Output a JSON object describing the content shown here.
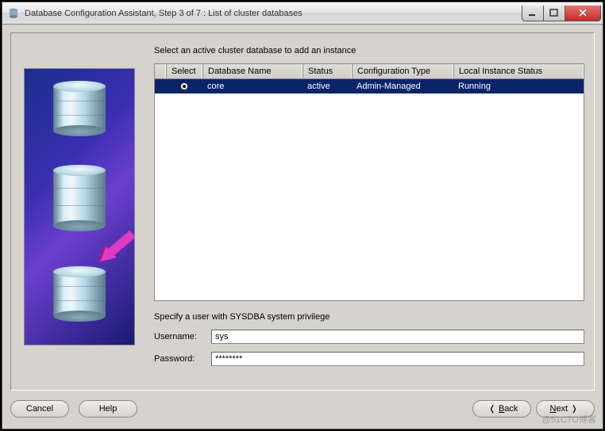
{
  "window": {
    "title": "Database Configuration Assistant, Step 3 of 7 : List of cluster databases"
  },
  "instruction": "Select an active cluster database to add an instance",
  "table": {
    "headers": {
      "select": "Select",
      "name": "Database Name",
      "status": "Status",
      "conf": "Configuration Type",
      "local": "Local Instance Status"
    },
    "rows": [
      {
        "name": "core",
        "status": "active",
        "conf": "Admin-Managed",
        "local": "Running"
      }
    ]
  },
  "privilege_label": "Specify a user with SYSDBA system privilege",
  "form": {
    "username_label": "Username:",
    "username_value": "sys",
    "password_label": "Password:",
    "password_value": "********"
  },
  "buttons": {
    "cancel": "Cancel",
    "help": "Help",
    "back": "Back",
    "next": "Next"
  },
  "watermark": "@51CTO博客"
}
